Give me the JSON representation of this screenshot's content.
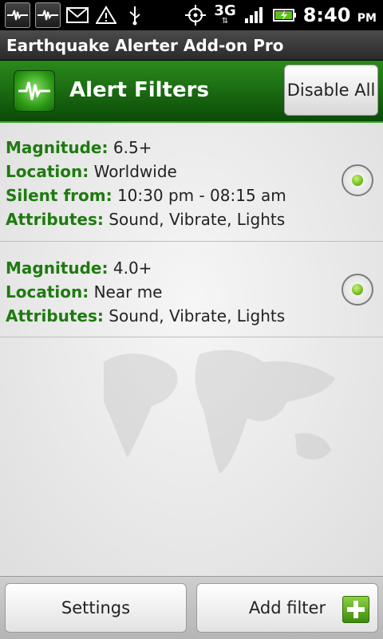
{
  "status_bar": {
    "network": "3G",
    "time": "8:40",
    "ampm": "PM",
    "icons": [
      "seismograph-icon",
      "seismograph-icon",
      "gmail-icon",
      "warning-icon",
      "usb-icon",
      "gps-icon",
      "signal-icon",
      "battery-icon"
    ]
  },
  "app": {
    "title": "Earthquake Alerter Add-on Pro"
  },
  "header": {
    "title": "Alert Filters",
    "disable_all_label": "Disable All"
  },
  "filters": [
    {
      "magnitude_label": "Magnitude:",
      "magnitude": "6.5+",
      "location_label": "Location:",
      "location": "Worldwide",
      "silent_label": "Silent from:",
      "silent": "10:30 pm - 08:15 am",
      "attributes_label": "Attributes:",
      "attributes": "Sound, Vibrate, Lights"
    },
    {
      "magnitude_label": "Magnitude:",
      "magnitude": "4.0+",
      "location_label": "Location:",
      "location": "Near me",
      "attributes_label": "Attributes:",
      "attributes": "Sound, Vibrate, Lights"
    }
  ],
  "bottom": {
    "settings_label": "Settings",
    "add_filter_label": "Add filter"
  }
}
